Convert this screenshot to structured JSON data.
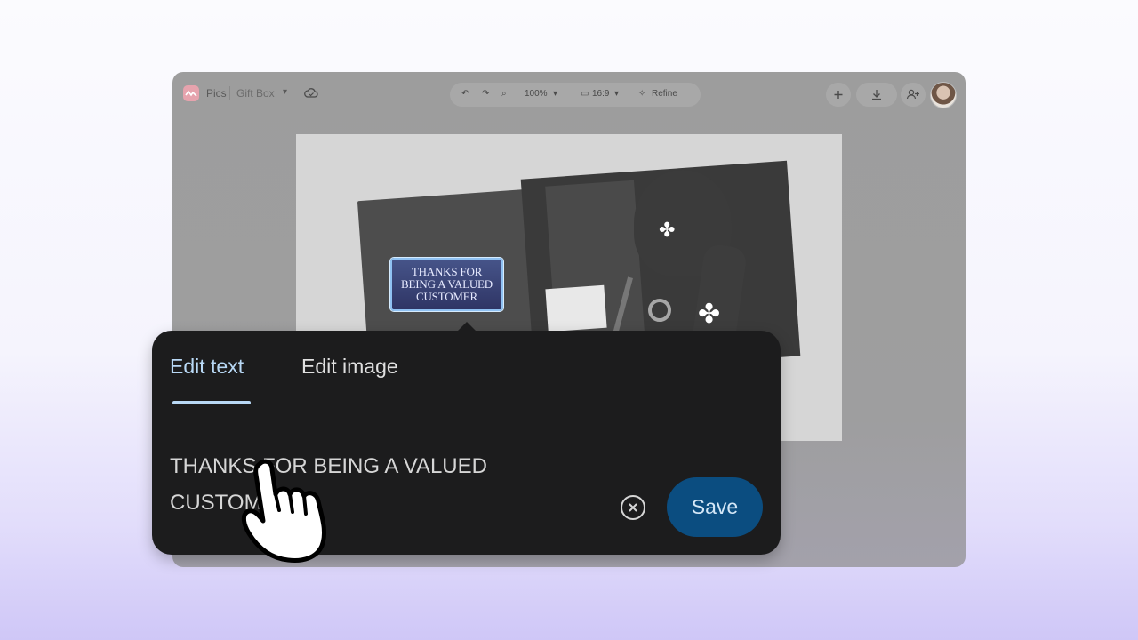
{
  "app": {
    "name": "Pics",
    "document_name": "Gift Box"
  },
  "toolbar": {
    "zoom": "100%",
    "aspect_ratio": "16:9",
    "refine_label": "Refine"
  },
  "canvas": {
    "badge_text": "THANKS FOR\nBEING A VALUED\nCUSTOMER"
  },
  "editor": {
    "tabs": [
      {
        "label": "Edit text",
        "active": true
      },
      {
        "label": "Edit image",
        "active": false
      }
    ],
    "text_value": "THANKS FOR BEING A VALUED CUSTOMER",
    "save_label": "Save"
  },
  "colors": {
    "accent_tab": "#b8d8f5",
    "save_button": "#0b4d80",
    "popover_bg": "#1c1c1d"
  }
}
